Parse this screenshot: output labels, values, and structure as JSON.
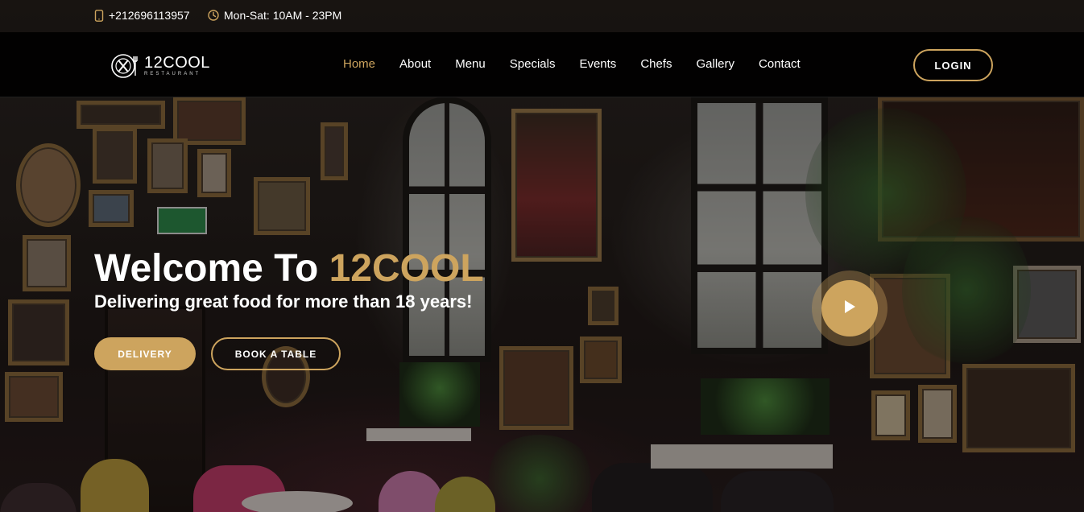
{
  "topbar": {
    "phone": "+212696113957",
    "phone_icon": "phone-icon",
    "hours": "Mon-Sat: 10AM - 23PM",
    "hours_icon": "clock-icon"
  },
  "logo": {
    "name": "12COOL",
    "subtitle": "RESTAURANT",
    "icon": "fork-knife-plate-icon"
  },
  "nav": {
    "items": [
      {
        "label": "Home",
        "active": true
      },
      {
        "label": "About",
        "active": false
      },
      {
        "label": "Menu",
        "active": false
      },
      {
        "label": "Specials",
        "active": false
      },
      {
        "label": "Events",
        "active": false
      },
      {
        "label": "Chefs",
        "active": false
      },
      {
        "label": "Gallery",
        "active": false
      },
      {
        "label": "Contact",
        "active": false
      }
    ],
    "login_label": "LOGIN"
  },
  "hero": {
    "welcome_prefix": "Welcome To ",
    "welcome_brand": "12COOL",
    "subtitle": "Delivering great food for more than 18 years!",
    "delivery_label": "DELIVERY",
    "book_label": "BOOK A TABLE",
    "play_icon": "play-icon"
  },
  "colors": {
    "accent": "#cda45e",
    "header_bg": "#000000",
    "text": "#ffffff"
  }
}
